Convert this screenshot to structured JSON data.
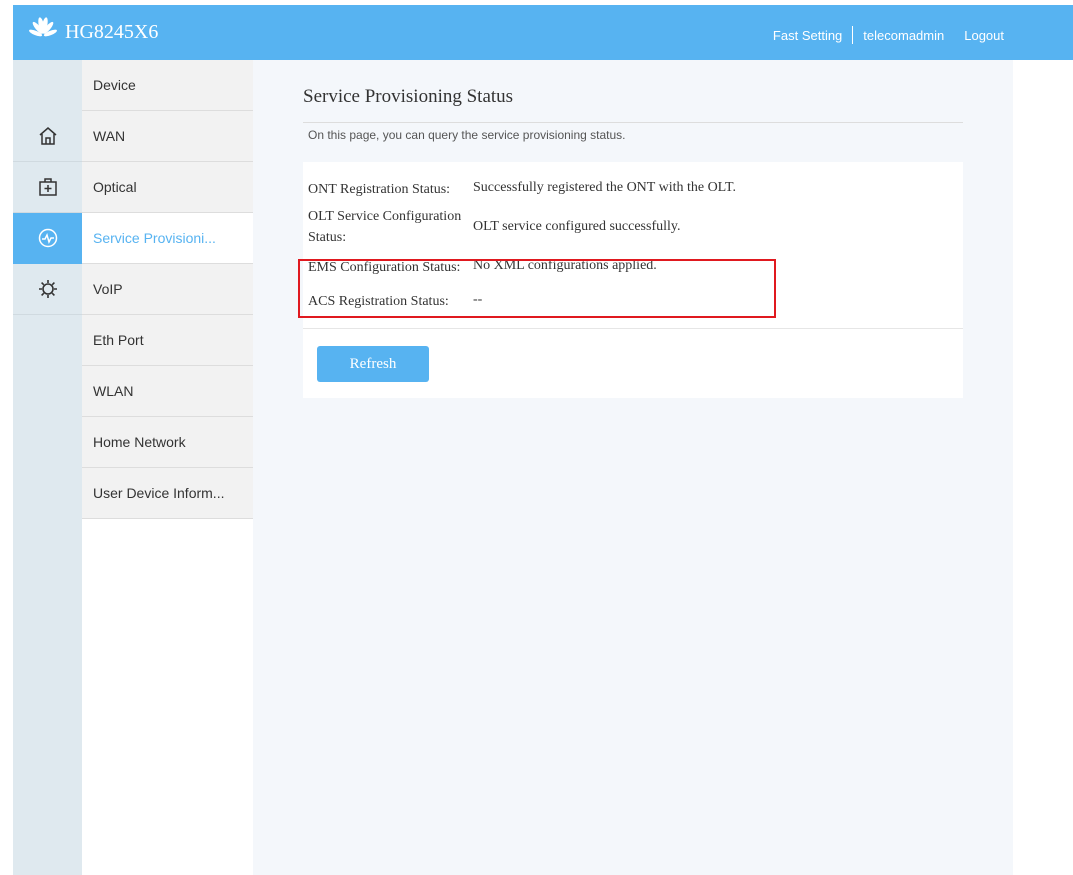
{
  "header": {
    "product_name": "HG8245X6",
    "fast_setting": "Fast Setting",
    "username": "telecomadmin",
    "logout": "Logout",
    "brand_color": "#57b3f1"
  },
  "icon_bar": [
    {
      "icon": "home-icon",
      "active": false
    },
    {
      "icon": "plus-box-icon",
      "active": false
    },
    {
      "icon": "status-pulse-icon",
      "active": true
    },
    {
      "icon": "gear-icon",
      "active": false
    }
  ],
  "menu": {
    "items": [
      {
        "label": "Device"
      },
      {
        "label": "WAN"
      },
      {
        "label": "Optical"
      },
      {
        "label": "Service Provisioni..."
      },
      {
        "label": "VoIP"
      },
      {
        "label": "Eth Port"
      },
      {
        "label": "WLAN"
      },
      {
        "label": "Home Network"
      },
      {
        "label": "User Device Inform..."
      }
    ],
    "active_index": 3
  },
  "page": {
    "title": "Service Provisioning Status",
    "description": "On this page, you can query the service provisioning status.",
    "rows": [
      {
        "label": "ONT Registration Status:",
        "value": "Successfully registered the ONT with the OLT."
      },
      {
        "label": "OLT Service Configuration Status:",
        "value": "OLT service configured successfully."
      },
      {
        "label": "EMS Configuration Status:",
        "value": "No XML configurations applied."
      },
      {
        "label": "ACS Registration Status:",
        "value": "--"
      }
    ],
    "refresh_label": "Refresh"
  },
  "highlight_color": "#e0191f"
}
